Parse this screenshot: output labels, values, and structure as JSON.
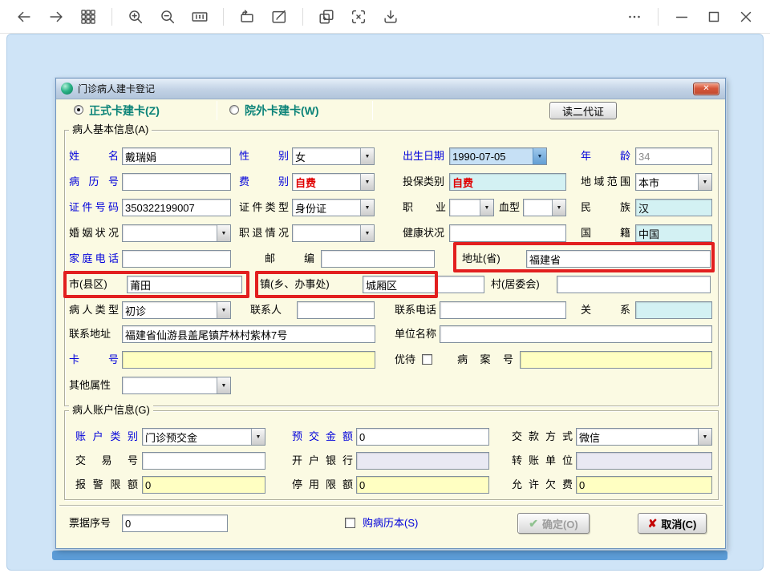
{
  "toolbar": {
    "icon_names": [
      "back",
      "forward",
      "apps-grid",
      "zoom-in",
      "zoom-out",
      "actual-size",
      "rotate",
      "edit",
      "copy-image",
      "text-recognition",
      "download",
      "more",
      "minimize",
      "maximize",
      "close"
    ]
  },
  "dialog": {
    "title": "门诊病人建卡登记",
    "card_modes": [
      {
        "label": "正式卡建卡(Z)",
        "selected": true
      },
      {
        "label": "院外卡建卡(W)",
        "selected": false
      }
    ],
    "read_id_button": "读二代证",
    "basic": {
      "legend": "病人基本信息(A)",
      "name": {
        "label": "姓名",
        "value": "戴瑞娟"
      },
      "gender": {
        "label": "性别",
        "value": "女"
      },
      "birth_date": {
        "label": "出生日期",
        "value": "1990-07-05"
      },
      "age": {
        "label": "年龄",
        "value": "34"
      },
      "medical_record_no": {
        "label": "病历号",
        "value": ""
      },
      "fee_type": {
        "label": "费别",
        "value": "自费"
      },
      "insurance_type": {
        "label": "投保类别",
        "value": "自费"
      },
      "region": {
        "label": "地域范围",
        "value": "本市"
      },
      "id_number": {
        "label": "证件号码",
        "value": "350322199007"
      },
      "id_type": {
        "label": "证件类型",
        "value": "身份证"
      },
      "occupation": {
        "label": "职业",
        "value": ""
      },
      "blood_type": {
        "label": "血型",
        "value": ""
      },
      "ethnicity": {
        "label": "民族",
        "value": "汉"
      },
      "marital": {
        "label": "婚姻状况",
        "value": ""
      },
      "employment": {
        "label": "职退情况",
        "value": ""
      },
      "health": {
        "label": "健康状况",
        "value": ""
      },
      "nationality": {
        "label": "国籍",
        "value": "中国"
      },
      "home_phone": {
        "label": "家庭电话",
        "value": ""
      },
      "postcode": {
        "label": "邮编",
        "value": ""
      },
      "province": {
        "label": "地址(省)",
        "value": "福建省"
      },
      "city": {
        "label": "市(县区)",
        "value": "莆田"
      },
      "town": {
        "label": "镇(乡、办事处)",
        "value": "城厢区"
      },
      "village": {
        "label": "村(居委会)",
        "value": ""
      },
      "patient_type": {
        "label": "病人类型",
        "value": "初诊"
      },
      "contact_person": {
        "label": "联系人",
        "value": ""
      },
      "contact_phone": {
        "label": "联系电话",
        "value": ""
      },
      "relationship": {
        "label": "关系",
        "value": ""
      },
      "contact_address": {
        "label": "联系地址",
        "value": "福建省仙游县盖尾镇芹林村紫林7号"
      },
      "employer": {
        "label": "单位名称",
        "value": ""
      },
      "card_no": {
        "label": "卡号",
        "value": ""
      },
      "preferential": {
        "label": "优待",
        "checked": false
      },
      "case_no": {
        "label": "病案号",
        "value": ""
      },
      "other_attr": {
        "label": "其他属性",
        "value": ""
      }
    },
    "account": {
      "legend": "病人账户信息(G)",
      "account_type": {
        "label": "账户类别",
        "value": "门诊预交金"
      },
      "deposit": {
        "label": "预交金额",
        "value": "0"
      },
      "payment_method": {
        "label": "交款方式",
        "value": "微信"
      },
      "transaction_no": {
        "label": "交易号",
        "value": ""
      },
      "bank": {
        "label": "开户银行",
        "value": ""
      },
      "transfer_unit": {
        "label": "转账单位",
        "value": ""
      },
      "alarm_limit": {
        "label": "报警限额",
        "value": "0"
      },
      "stop_limit": {
        "label": "停用限额",
        "value": "0"
      },
      "allow_debt": {
        "label": "允许欠费",
        "value": "0"
      }
    },
    "footer": {
      "receipt": {
        "label": "票据序号",
        "value": "0"
      },
      "buy_record": {
        "label": "购病历本(S)",
        "checked": false
      },
      "ok_label": "确定(O)",
      "cancel_label": "取消(C)"
    }
  },
  "colors": {
    "label_blue": "#0000db",
    "value_red": "#e00000",
    "radio_teal": "#0b8378",
    "field_yellow": "#ffffc2",
    "field_cyan": "#d3f1f3",
    "annotation_red": "#e21f1f"
  }
}
